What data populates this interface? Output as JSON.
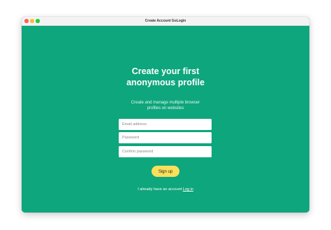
{
  "window": {
    "title": "Create Account GoLogin"
  },
  "main": {
    "heading_line1": "Create your first",
    "heading_line2": "anonymous profile",
    "subtitle_line1": "Create and manage multiple browser",
    "subtitle_line2": "profiles on websites"
  },
  "form": {
    "email_placeholder": "Email address",
    "password_placeholder": "Password",
    "confirm_placeholder": "Confirm password",
    "signup_label": "Sign up"
  },
  "footer": {
    "text": "I already have an account",
    "login_link": "Log in"
  },
  "colors": {
    "background": "#0ea67c",
    "button": "#f9e05a"
  }
}
